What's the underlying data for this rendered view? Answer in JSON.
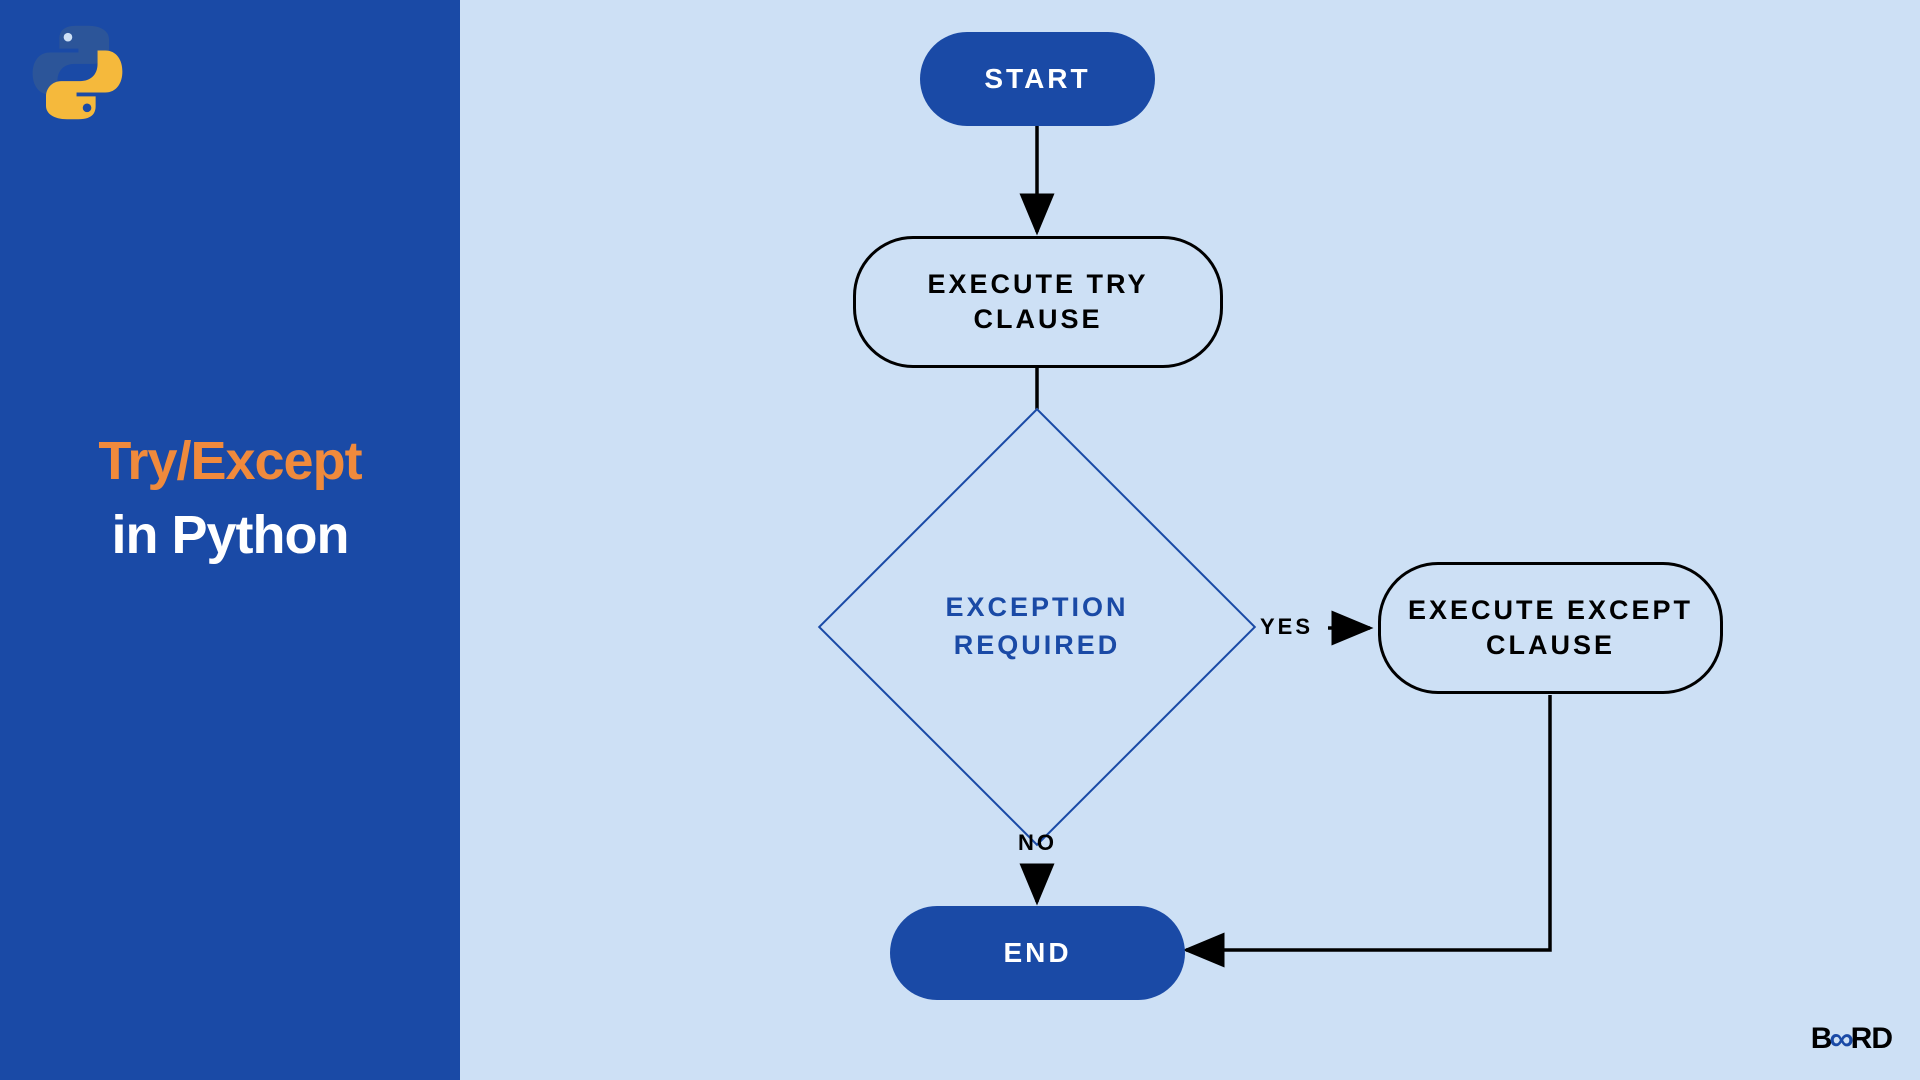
{
  "sidebar": {
    "title_line1": "Try/Except",
    "title_line2": "in Python"
  },
  "flowchart": {
    "start": "START",
    "try_clause": "EXECUTE TRY CLAUSE",
    "decision": "EXCEPTION REQUIRED",
    "except_clause": "EXECUTE EXCEPT CLAUSE",
    "yes_label": "YES",
    "no_label": "NO",
    "end": "END"
  },
  "brand": {
    "name_part1": "B",
    "name_part2": "RD"
  },
  "colors": {
    "sidebar_bg": "#1a4aa6",
    "main_bg": "#cde0f5",
    "accent_orange": "#f08a3c",
    "diamond_text": "#1a4aa6"
  },
  "nodes": [
    {
      "id": "start",
      "type": "terminator",
      "label": "START"
    },
    {
      "id": "try",
      "type": "process",
      "label": "EXECUTE TRY CLAUSE"
    },
    {
      "id": "decision",
      "type": "decision",
      "label": "EXCEPTION REQUIRED"
    },
    {
      "id": "except",
      "type": "process",
      "label": "EXECUTE EXCEPT CLAUSE"
    },
    {
      "id": "end",
      "type": "terminator",
      "label": "END"
    }
  ],
  "edges": [
    {
      "from": "start",
      "to": "try",
      "label": null
    },
    {
      "from": "try",
      "to": "decision",
      "label": null
    },
    {
      "from": "decision",
      "to": "except",
      "label": "YES"
    },
    {
      "from": "decision",
      "to": "end",
      "label": "NO"
    },
    {
      "from": "except",
      "to": "end",
      "label": null
    }
  ]
}
